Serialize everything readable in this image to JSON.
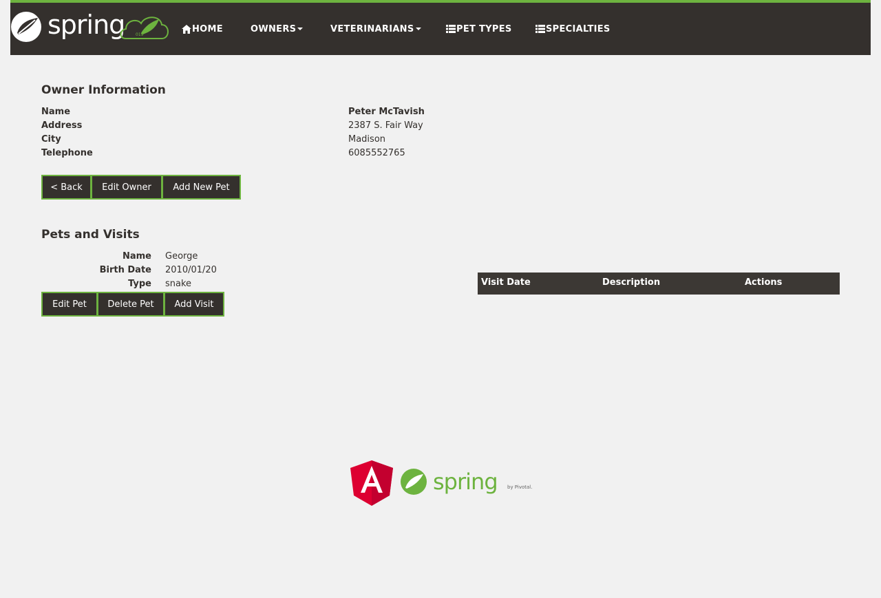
{
  "nav": {
    "brand": "spring",
    "items": [
      {
        "label": "HOME",
        "icon": "home-icon"
      },
      {
        "label": "OWNERS",
        "icon": "caret-down-icon"
      },
      {
        "label": "VETERINARIANS",
        "icon": "caret-down-icon"
      },
      {
        "label": "PET TYPES",
        "icon": "list-icon"
      },
      {
        "label": "SPECIALTIES",
        "icon": "list-icon"
      }
    ]
  },
  "owner": {
    "heading": "Owner Information",
    "fields": [
      {
        "label": "Name",
        "value": "Peter McTavish"
      },
      {
        "label": "Address",
        "value": "2387 S. Fair Way"
      },
      {
        "label": "City",
        "value": "Madison"
      },
      {
        "label": "Telephone",
        "value": "6085552765"
      }
    ],
    "buttons": {
      "back": "< Back",
      "edit": "Edit Owner",
      "add_pet": "Add New Pet"
    }
  },
  "pets": {
    "heading": "Pets and Visits",
    "pet": [
      {
        "label": "Name",
        "value": "George"
      },
      {
        "label": "Birth Date",
        "value": "2010/01/20"
      },
      {
        "label": "Type",
        "value": "snake"
      }
    ],
    "buttons": {
      "edit": "Edit Pet",
      "delete": "Delete Pet",
      "add_visit": "Add Visit"
    },
    "visit_columns": [
      "Visit Date",
      "Description",
      "Actions"
    ]
  },
  "footer": {
    "spring_text": "spring",
    "by_text": "by Pivotal."
  },
  "colors": {
    "accent": "#6db33f",
    "nav_bg": "#34302d",
    "angular_red": "#dd0031"
  }
}
